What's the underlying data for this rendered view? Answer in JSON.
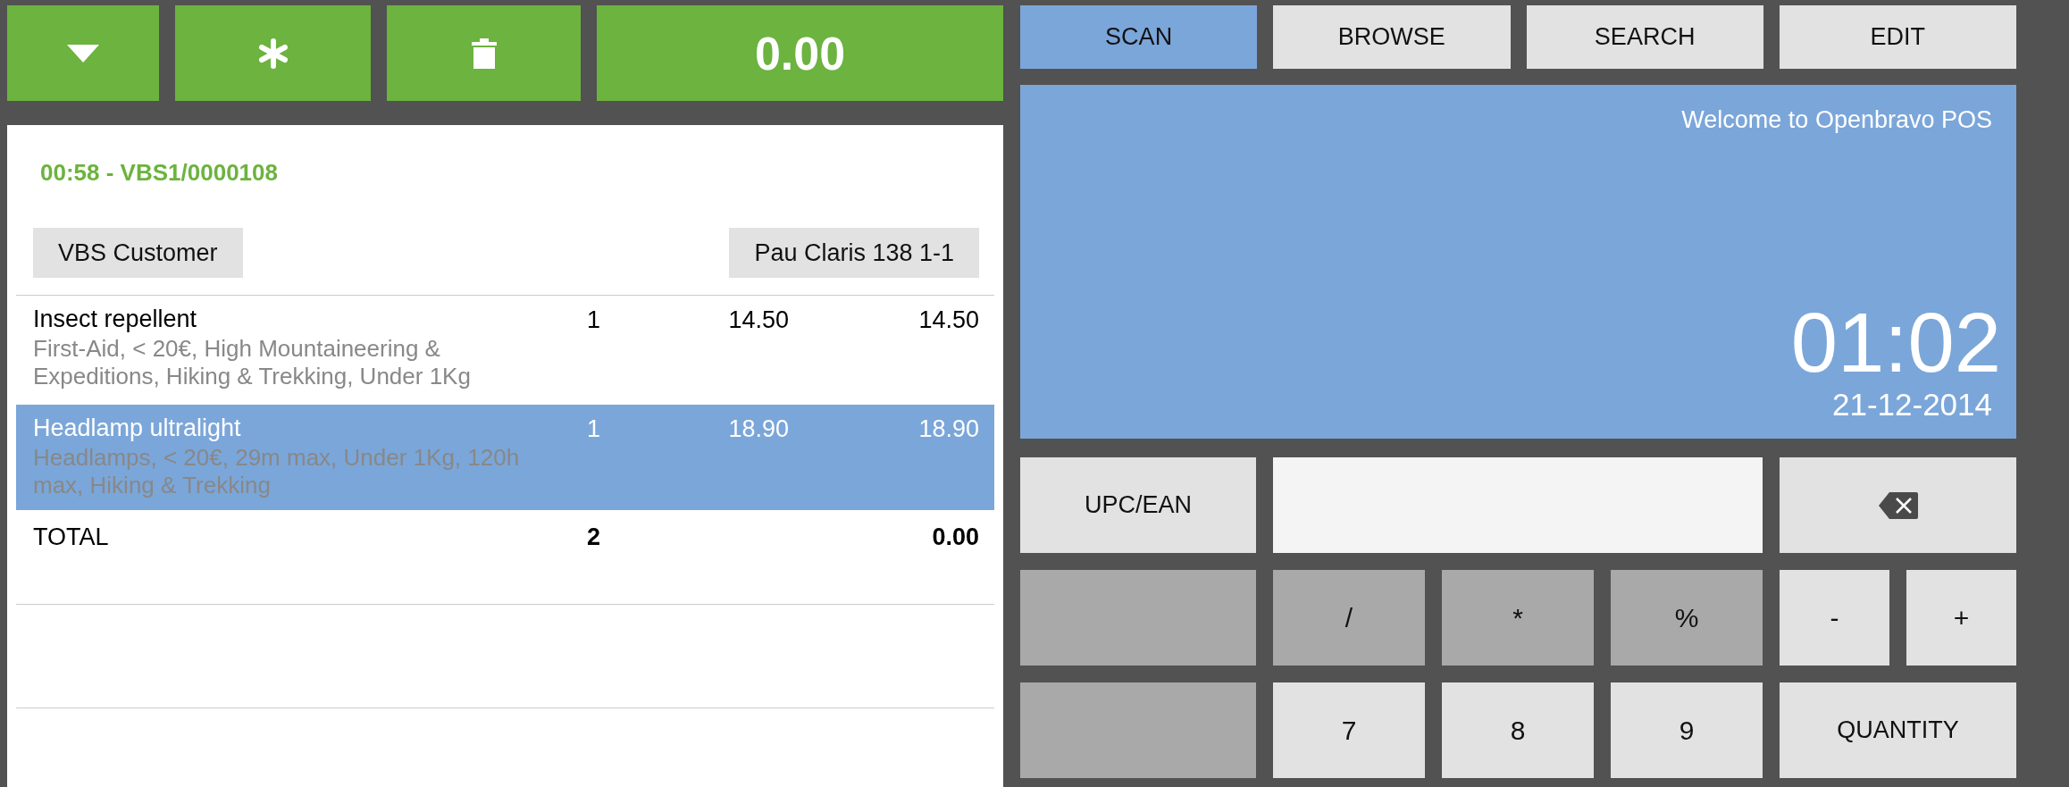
{
  "toolbar": {
    "buttons": [
      {
        "kind": "menu"
      },
      {
        "kind": "asterisk"
      },
      {
        "kind": "delete"
      }
    ],
    "total": "0.00"
  },
  "ticket": {
    "title": "00:58 - VBS1/0000108",
    "customer": "VBS Customer",
    "location": "Pau Claris 138 1-1",
    "lines": [
      {
        "name": "Insect repellent",
        "description": "First-Aid, < 20€, High Mountaineering & Expeditions, Hiking & Trekking, Under 1Kg",
        "qty": "1",
        "price": "14.50",
        "amount": "14.50",
        "selected": false
      },
      {
        "name": "Headlamp ultralight",
        "description": "Headlamps, < 20€, 29m max, Under 1Kg, 120h max, Hiking & Trekking",
        "qty": "1",
        "price": "18.90",
        "amount": "18.90",
        "selected": true
      }
    ],
    "total": {
      "label": "TOTAL",
      "qty": "2",
      "amount": "0.00"
    }
  },
  "tabs": [
    {
      "label": "SCAN",
      "selected": true
    },
    {
      "label": "BROWSE",
      "selected": false
    },
    {
      "label": "SEARCH",
      "selected": false
    },
    {
      "label": "EDIT",
      "selected": false
    }
  ],
  "display": {
    "welcome": "Welcome to Openbravo POS",
    "time": "01:02",
    "date": "21-12-2014"
  },
  "scan": {
    "mode": "UPC/EAN"
  },
  "keypad": [
    [
      {
        "kind": "blank"
      },
      {
        "kind": "operator",
        "label": "/"
      },
      {
        "kind": "operator",
        "label": "*"
      },
      {
        "kind": "operator",
        "label": "%"
      },
      {
        "kind": "sign",
        "label": "-"
      },
      {
        "kind": "sign",
        "label": "+"
      }
    ],
    [
      {
        "kind": "blank"
      },
      {
        "kind": "digit",
        "label": "7"
      },
      {
        "kind": "digit",
        "label": "8"
      },
      {
        "kind": "digit",
        "label": "9"
      },
      {
        "kind": "command",
        "label": "QUANTITY"
      }
    ]
  ]
}
